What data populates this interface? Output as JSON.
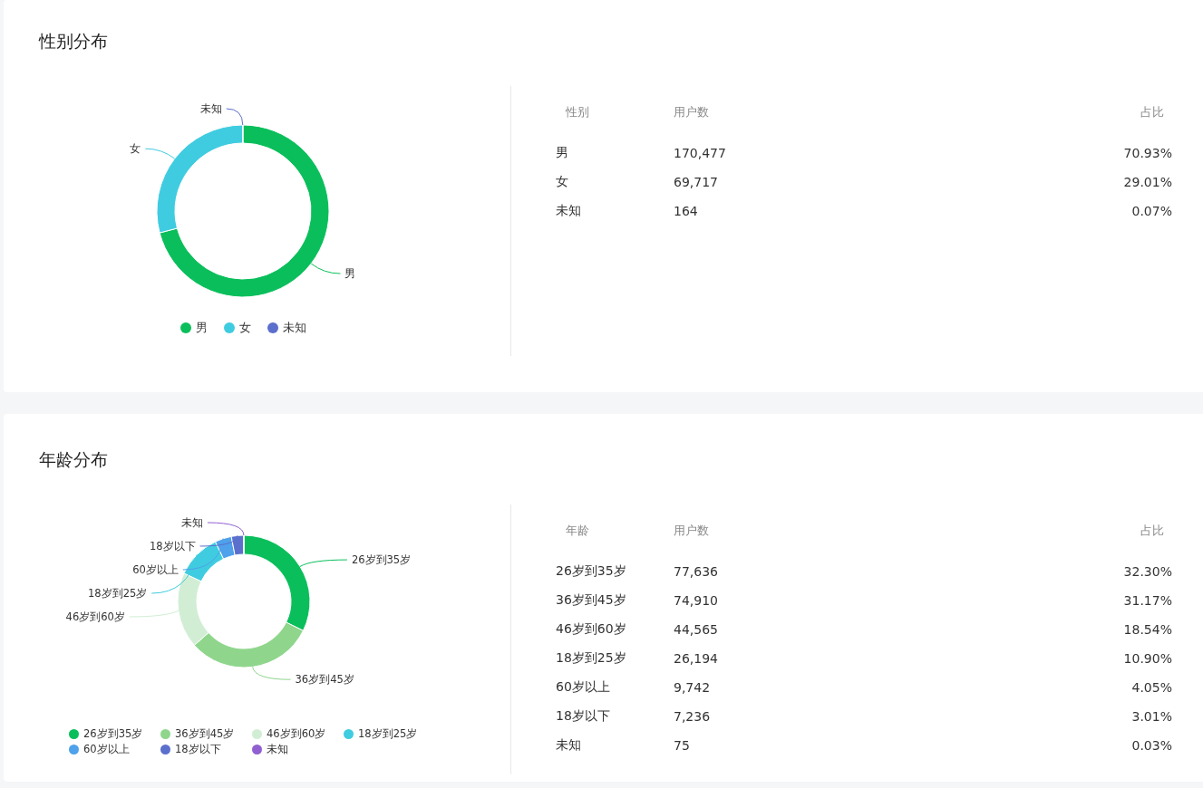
{
  "sections": [
    {
      "title": "性别分布",
      "chart_data": {
        "type": "donut",
        "categories": [
          "男",
          "女",
          "未知"
        ],
        "values": [
          70.93,
          29.01,
          0.07
        ],
        "legend": "bottom",
        "colors": [
          "#0abf5b",
          "#40cce0",
          "#5b6fcc"
        ]
      },
      "table": {
        "columns": [
          "性别",
          "用户数",
          "占比"
        ],
        "rows": [
          [
            "男",
            "170,477",
            "70.93%"
          ],
          [
            "女",
            "69,717",
            "29.01%"
          ],
          [
            "未知",
            "164",
            "0.07%"
          ]
        ]
      }
    },
    {
      "title": "年龄分布",
      "chart_data": {
        "type": "donut",
        "categories": [
          "26岁到35岁",
          "36岁到45岁",
          "46岁到60岁",
          "18岁到25岁",
          "60岁以上",
          "18岁以下",
          "未知"
        ],
        "values": [
          32.3,
          31.17,
          18.54,
          10.9,
          4.05,
          3.01,
          0.03
        ],
        "legend": "bottom",
        "colors": [
          "#0abf5b",
          "#8fd68c",
          "#d1eed4",
          "#40cce0",
          "#4ea1ea",
          "#5b6fcc",
          "#9060d0"
        ]
      },
      "table": {
        "columns": [
          "年龄",
          "用户数",
          "占比"
        ],
        "rows": [
          [
            "26岁到35岁",
            "77,636",
            "32.30%"
          ],
          [
            "36岁到45岁",
            "74,910",
            "31.17%"
          ],
          [
            "46岁到60岁",
            "44,565",
            "18.54%"
          ],
          [
            "18岁到25岁",
            "26,194",
            "10.90%"
          ],
          [
            "60岁以上",
            "9,742",
            "4.05%"
          ],
          [
            "18岁以下",
            "7,236",
            "3.01%"
          ],
          [
            "未知",
            "75",
            "0.03%"
          ]
        ]
      }
    }
  ]
}
